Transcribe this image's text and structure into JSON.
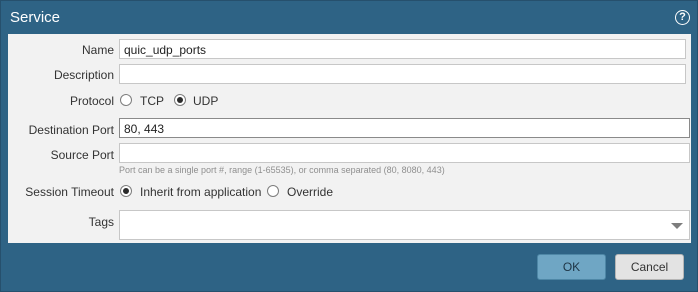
{
  "dialog": {
    "title": "Service",
    "help_icon": "help-icon"
  },
  "form": {
    "name_label": "Name",
    "name_value": "quic_udp_ports",
    "description_label": "Description",
    "description_value": "",
    "protocol_label": "Protocol",
    "protocol_options": [
      {
        "label": "TCP",
        "checked": false
      },
      {
        "label": "UDP",
        "checked": true
      }
    ],
    "destination_port_label": "Destination Port",
    "destination_port_value": "80, 443",
    "source_port_label": "Source Port",
    "source_port_value": "",
    "port_hint": "Port can be a single port #, range (1-65535), or comma separated (80, 8080, 443)",
    "session_timeout_label": "Session Timeout",
    "session_timeout_options": [
      {
        "label": "Inherit from application",
        "checked": true
      },
      {
        "label": "Override",
        "checked": false
      }
    ],
    "tags_label": "Tags",
    "tags_value": ""
  },
  "buttons": {
    "ok_label": "OK",
    "cancel_label": "Cancel"
  },
  "colors": {
    "frame": "#2e6385",
    "panel": "#f2f2f2",
    "ok_button": "#6fa6c4",
    "cancel_button": "#e3e3e3"
  }
}
